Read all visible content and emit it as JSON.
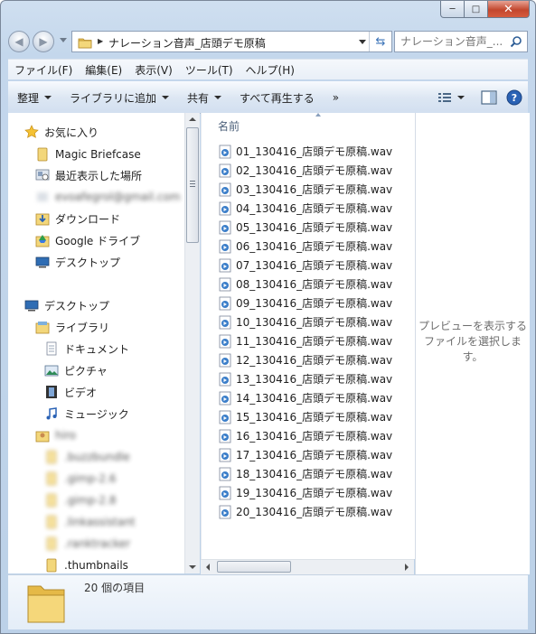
{
  "window": {
    "minimize": "─",
    "maximize": "□",
    "close": "✕"
  },
  "address": {
    "path": "ナレーション音声_店頭デモ原稿"
  },
  "search": {
    "placeholder": "ナレーション音声_..."
  },
  "menu": [
    "ファイル(F)",
    "編集(E)",
    "表示(V)",
    "ツール(T)",
    "ヘルプ(H)"
  ],
  "toolbar": {
    "organize": "整理",
    "add_to_library": "ライブラリに追加",
    "share": "共有",
    "play_all": "すべて再生する",
    "more": "»"
  },
  "sidebar": {
    "favorites": "お気に入り",
    "fav_items": [
      "Magic Briefcase",
      "最近表示した場所",
      "evoafegrol@gmail.com",
      "ダウンロード",
      "Google ドライブ",
      "デスクトップ"
    ],
    "desktop": "デスクトップ",
    "libraries": "ライブラリ",
    "lib_items": [
      "ドキュメント",
      "ピクチャ",
      "ビデオ",
      "ミュージック"
    ],
    "user": "hiro",
    "user_items": [
      ".buzzbundle",
      ".gimp-2.6",
      ".gimp-2.8",
      ".linkassistant",
      ".ranktracker",
      ".thumbnails"
    ]
  },
  "content": {
    "column_name": "名前",
    "files": [
      "01_130416_店頭デモ原稿.wav",
      "02_130416_店頭デモ原稿.wav",
      "03_130416_店頭デモ原稿.wav",
      "04_130416_店頭デモ原稿.wav",
      "05_130416_店頭デモ原稿.wav",
      "06_130416_店頭デモ原稿.wav",
      "07_130416_店頭デモ原稿.wav",
      "08_130416_店頭デモ原稿.wav",
      "09_130416_店頭デモ原稿.wav",
      "10_130416_店頭デモ原稿.wav",
      "11_130416_店頭デモ原稿.wav",
      "12_130416_店頭デモ原稿.wav",
      "13_130416_店頭デモ原稿.wav",
      "14_130416_店頭デモ原稿.wav",
      "15_130416_店頭デモ原稿.wav",
      "16_130416_店頭デモ原稿.wav",
      "17_130416_店頭デモ原稿.wav",
      "18_130416_店頭デモ原稿.wav",
      "19_130416_店頭デモ原稿.wav",
      "20_130416_店頭デモ原稿.wav"
    ]
  },
  "preview": {
    "message": "プレビューを表示するファイルを選択します。"
  },
  "status": {
    "item_count": "20 個の項目"
  }
}
